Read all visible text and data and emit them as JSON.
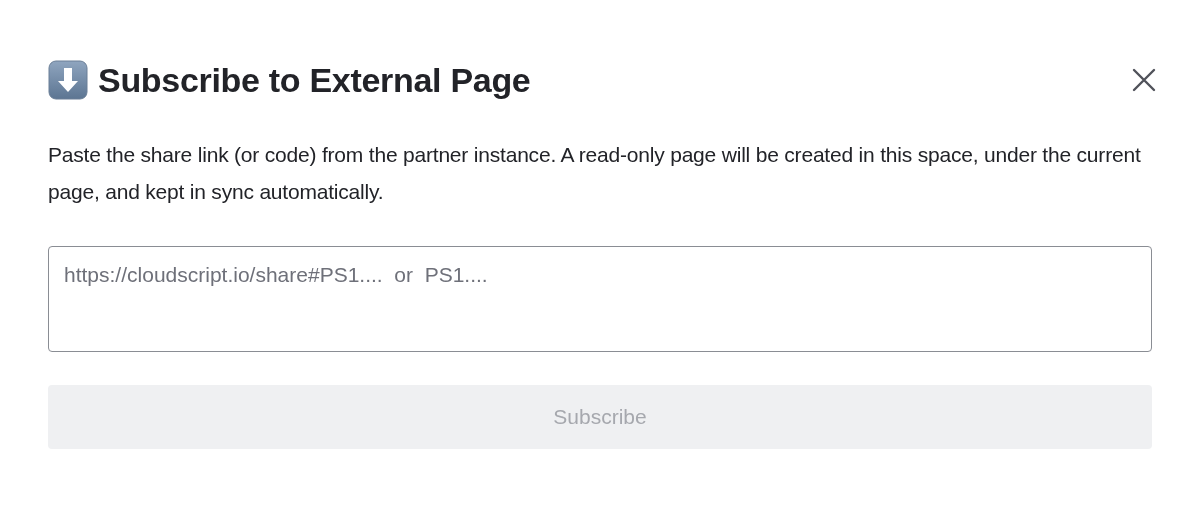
{
  "dialog": {
    "title": "Subscribe to External Page",
    "description": "Paste the share link (or code) from the partner instance. A read-only page will be created in this space, under the current page, and kept in sync automatically.",
    "field": {
      "placeholder": "https://cloudscript.io/share#PS1....  or  PS1...."
    },
    "button": {
      "label": "Subscribe",
      "disabled": true
    }
  }
}
